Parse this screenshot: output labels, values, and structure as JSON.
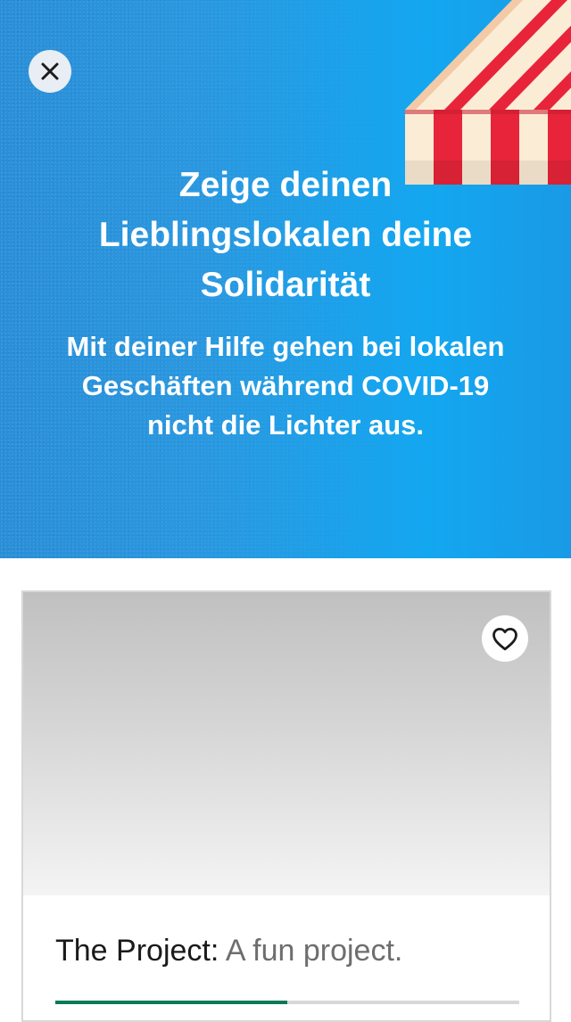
{
  "hero": {
    "title": "Zeige deinen Lieblingslokalen deine Solidarität",
    "subtitle": "Mit deiner Hilfe gehen bei lokalen Geschäften während COVID-19 nicht die Lichter aus.",
    "close_icon": "close-icon",
    "illustration": "striped-awning",
    "colors": {
      "background": "#2a98e0",
      "awning_red": "#e8243a",
      "awning_cream": "#fbecd6"
    }
  },
  "card": {
    "title_name": "The Project:",
    "title_blurb": "A fun project.",
    "favorite_icon": "heart-outline-icon",
    "progress": 0.5,
    "progress_color": "#0a7a55"
  }
}
